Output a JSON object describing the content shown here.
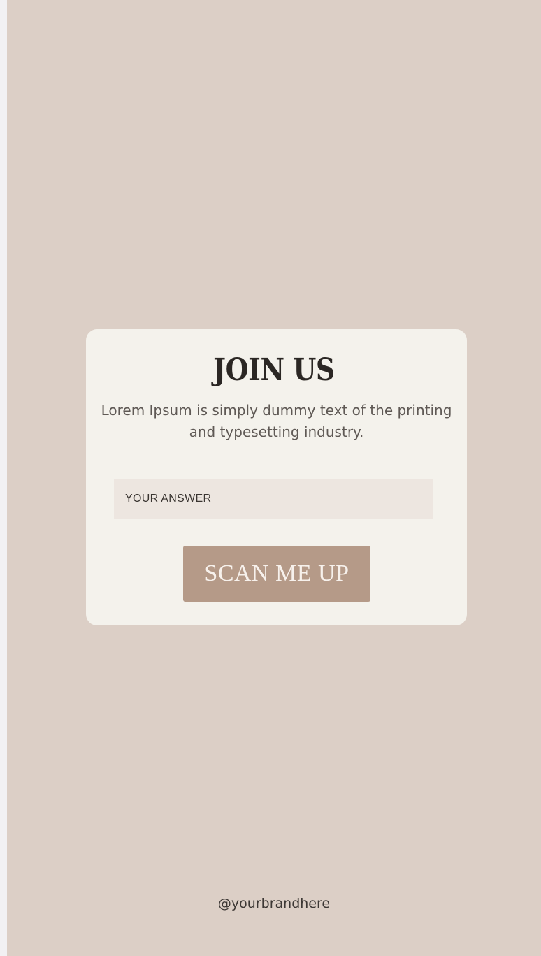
{
  "colors": {
    "background": "#dccfc6",
    "card": "#f4f2ec",
    "input": "#ede6e0",
    "button": "#b59a88",
    "button_text": "#f7f1ec",
    "heading": "#2b2724"
  },
  "card": {
    "title": "JOIN US",
    "subtitle": "Lorem Ipsum is simply dummy text of the printing and typesetting industry.",
    "answer_field": {
      "placeholder": "YOUR ANSWER",
      "value": ""
    },
    "button_label": "SCAN ME UP"
  },
  "footer": {
    "brand_handle": "@yourbrandhere"
  }
}
